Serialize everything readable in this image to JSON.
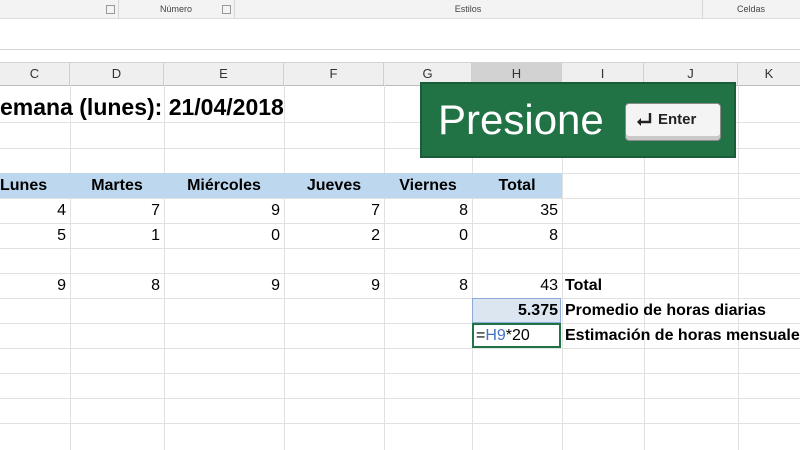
{
  "ribbon": {
    "groups": [
      "Número",
      "Estilos",
      "Celdas"
    ]
  },
  "columns": [
    "C",
    "D",
    "E",
    "F",
    "G",
    "H",
    "I",
    "J",
    "K"
  ],
  "selected_column": "H",
  "sheet": {
    "title": "emana (lunes): 21/04/2018",
    "headers": [
      "Lunes",
      "Martes",
      "Miércoles",
      "Jueves",
      "Viernes",
      "Total"
    ],
    "rows": [
      [
        "4",
        "7",
        "9",
        "7",
        "8",
        "35"
      ],
      [
        "5",
        "1",
        "0",
        "2",
        "0",
        "8"
      ],
      [
        "9",
        "8",
        "9",
        "9",
        "8",
        "43"
      ]
    ],
    "total_label": "Total",
    "average_value": "5.375",
    "average_label": "Promedio de horas diarias",
    "formula_ref": "H9",
    "formula_eq": "=",
    "formula_rest": "*20",
    "estimate_label": "Estimación de horas mensuales"
  },
  "banner": {
    "text": "Presione",
    "key_label": "Enter",
    "key_icon": "enter-arrow-icon",
    "color": "#217346"
  }
}
